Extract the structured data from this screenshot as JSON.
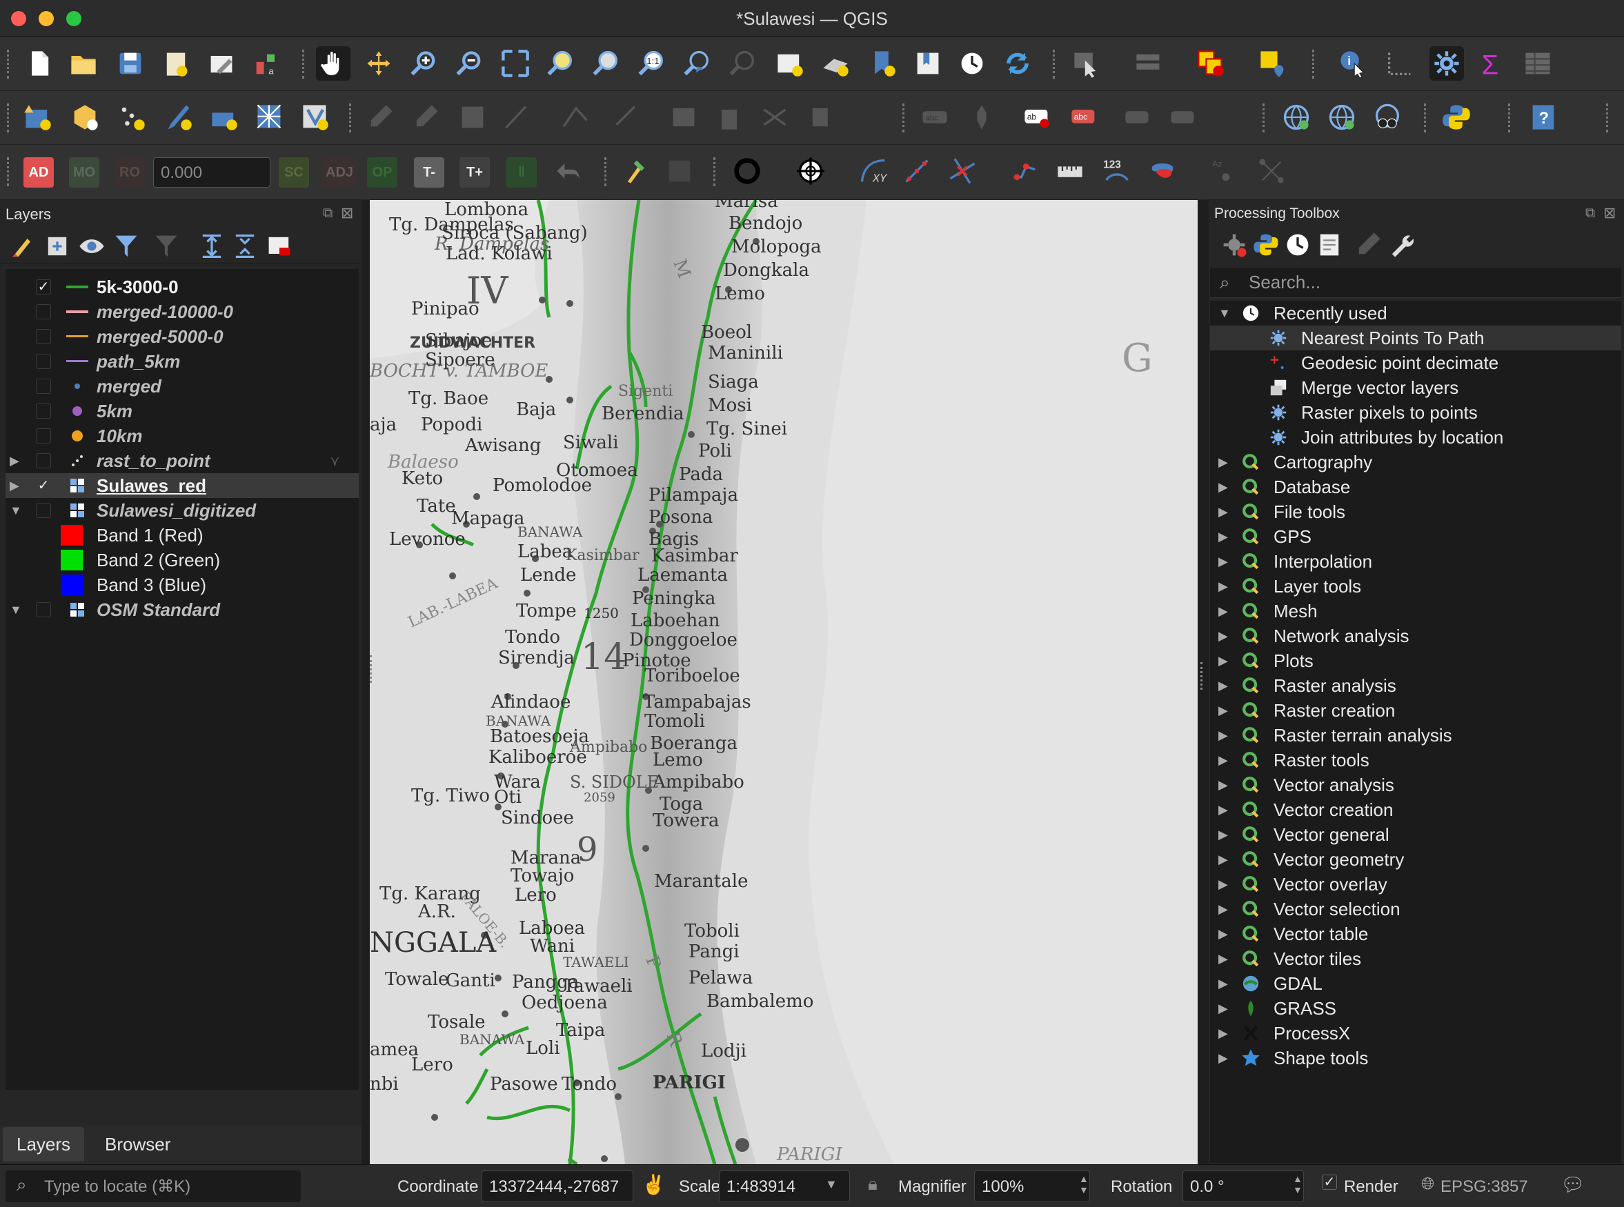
{
  "window": {
    "title": "*Sulawesi — QGIS"
  },
  "toolbar3": {
    "ad": "AD",
    "mo": "MO",
    "ro": "RO",
    "value": "0.000",
    "sc": "SC",
    "adj": "ADJ",
    "op": "OP",
    "tminus": "T-",
    "tplus": "T+",
    "xy": "XY",
    "n123": "123",
    "abc": "abc",
    "az": "Az"
  },
  "layers_panel": {
    "title": "Layers",
    "items": [
      {
        "label": "5k-3000-0",
        "checked": "✓",
        "style": "bd"
      },
      {
        "label": "merged-10000-0",
        "checked": "",
        "style": "it"
      },
      {
        "label": "merged-5000-0",
        "checked": "",
        "style": "it"
      },
      {
        "label": "path_5km",
        "checked": "",
        "style": "it"
      },
      {
        "label": "merged",
        "checked": "",
        "style": "it"
      },
      {
        "label": "5km",
        "checked": "",
        "style": "it"
      },
      {
        "label": "10km",
        "checked": "",
        "style": "it"
      },
      {
        "label": "rast_to_point",
        "checked": "",
        "style": "it"
      },
      {
        "label": "Sulawes_red",
        "checked": "✓",
        "style": "bd"
      },
      {
        "label": "Sulawesi_digitized",
        "checked": "",
        "style": "it"
      },
      {
        "label": "Band 1 (Red)",
        "checked": "",
        "style": "n"
      },
      {
        "label": "Band 2 (Green)",
        "checked": "",
        "style": "n"
      },
      {
        "label": "Band 3 (Blue)",
        "checked": "",
        "style": "n"
      },
      {
        "label": "OSM Standard",
        "checked": "",
        "style": "it"
      }
    ],
    "colors": {
      "line_green": "#2ea52e",
      "line_pink": "#e8a0a8",
      "line_orange": "#e0a020",
      "line_purple": "#9c7ac8",
      "point_blue": "#4a7fc0",
      "point_purple": "#a060c0",
      "point_orange": "#f0a020",
      "band_red": "#ff0000",
      "band_green": "#00e000",
      "band_blue": "#0000ff"
    }
  },
  "bottom_tabs": {
    "layers": "Layers",
    "browser": "Browser"
  },
  "processing": {
    "title": "Processing Toolbox",
    "search_placeholder": "Search...",
    "recent": "Recently used",
    "recent_items": [
      "Nearest Points To Path",
      "Geodesic point decimate",
      "Merge vector layers",
      "Raster pixels to points",
      "Join attributes by location"
    ],
    "groups": [
      "Cartography",
      "Database",
      "File tools",
      "GPS",
      "Interpolation",
      "Layer tools",
      "Mesh",
      "Network analysis",
      "Plots",
      "Raster analysis",
      "Raster creation",
      "Raster terrain analysis",
      "Raster tools",
      "Vector analysis",
      "Vector creation",
      "Vector general",
      "Vector geometry",
      "Vector overlay",
      "Vector selection",
      "Vector table",
      "Vector tiles",
      "GDAL",
      "GRASS",
      "ProcessX",
      "Shape tools"
    ]
  },
  "map": {
    "labels": [
      "Tg. Dampelas",
      "R. Dampelas",
      "Lombona",
      "Siroca (Sabang)",
      "Lad. Kolawi",
      "IV",
      "Marisa",
      "Bendojo",
      "Molopoga",
      "Dongkala",
      "Lemo",
      "Pinipao",
      "ZUIDWACHTER",
      "BOCHT v. TAMBOE",
      "Sibajoe",
      "Sipoere",
      "Boeol",
      "Maninili",
      "G",
      "Tg. Baoe",
      "Baja",
      "Sigenti",
      "Siaga",
      "Popodi",
      "Berendia",
      "Mosi",
      "Tg. Sinei",
      "Awisang",
      "Siwali",
      "Poli",
      "Keto",
      "Pomolodoe",
      "Otomoea",
      "Pada",
      "Tate",
      "Pilampaja",
      "Mapaga",
      "Posona",
      "Levonoe",
      "BANAWA",
      "Bagis",
      "Labea",
      "Kasimbar",
      "Kasimbar",
      "Lende",
      "Laemanta",
      "LAB.-LABEA",
      "Peningka",
      "Tompe",
      "1250",
      "Laboehan",
      "Tondo",
      "Donggoeloe",
      "14",
      "Sirendja",
      "Pinotoe",
      "Toriboeloe",
      "Alindaoe",
      "Tampabajas",
      "BANAWA",
      "Tomoli",
      "Batoesoeja",
      "Boeranga",
      "Kaliboeroe",
      "Lemo",
      "Ampibabo",
      "Ampibabo",
      "Tg. Tiwo",
      "Wara",
      "S. SIDOLE",
      "Toga",
      "Oti",
      "2059",
      "Towera",
      "Sindoee",
      "Marana",
      "9",
      "Towajo",
      "PALOE-B.",
      "Marantale",
      "Tg. Karang",
      "A.R.",
      "Lero",
      "NGGALA",
      "Laboea",
      "Toboli",
      "Wani",
      "TAWAELI",
      "Pangi",
      "Towale",
      "Ganti",
      "Pangga",
      "Tawaeli",
      "Pelawa",
      "Oedjoena",
      "Bambalemo",
      "Tosale",
      "BANAWA",
      "Taipa",
      "Loli",
      "Lodji",
      "amea",
      "Lero",
      "nbi",
      "Pasowe",
      "Tondo",
      "PARIGI",
      "PARIGI",
      "aja",
      "Balaeso",
      "P",
      "R",
      "M"
    ]
  },
  "status": {
    "locator_placeholder": "Type to locate (⌘K)",
    "coordinate_label": "Coordinate",
    "coordinate_value": "13372444,-27687",
    "scale_label": "Scale",
    "scale_value": "1:483914",
    "magnifier_label": "Magnifier",
    "magnifier_value": "100%",
    "rotation_label": "Rotation",
    "rotation_value": "0.0 °",
    "render_label": "Render",
    "crs": "EPSG:3857"
  }
}
